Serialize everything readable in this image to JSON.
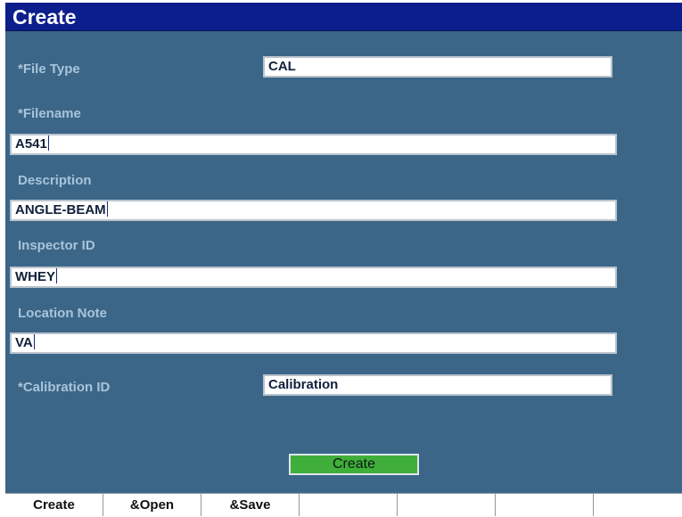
{
  "window": {
    "title": "Create"
  },
  "form": {
    "file_type": {
      "label": "*File Type",
      "value": "CAL"
    },
    "filename": {
      "label": "*Filename",
      "value": "A541"
    },
    "description": {
      "label": "Description",
      "value": "ANGLE-BEAM"
    },
    "inspector_id": {
      "label": "Inspector ID",
      "value": "WHEY"
    },
    "location_note": {
      "label": "Location Note",
      "value": "VA"
    },
    "calibration_id": {
      "label": "*Calibration ID",
      "value": "Calibration"
    },
    "create_button": "Create"
  },
  "soft_keys": [
    "Create",
    "&Open",
    "&Save",
    "",
    "",
    "",
    ""
  ],
  "colors": {
    "title_bar": "#0c1d8c",
    "panel": "#3b6688",
    "label_text": "#a8c4da",
    "button": "#3fae3a"
  }
}
